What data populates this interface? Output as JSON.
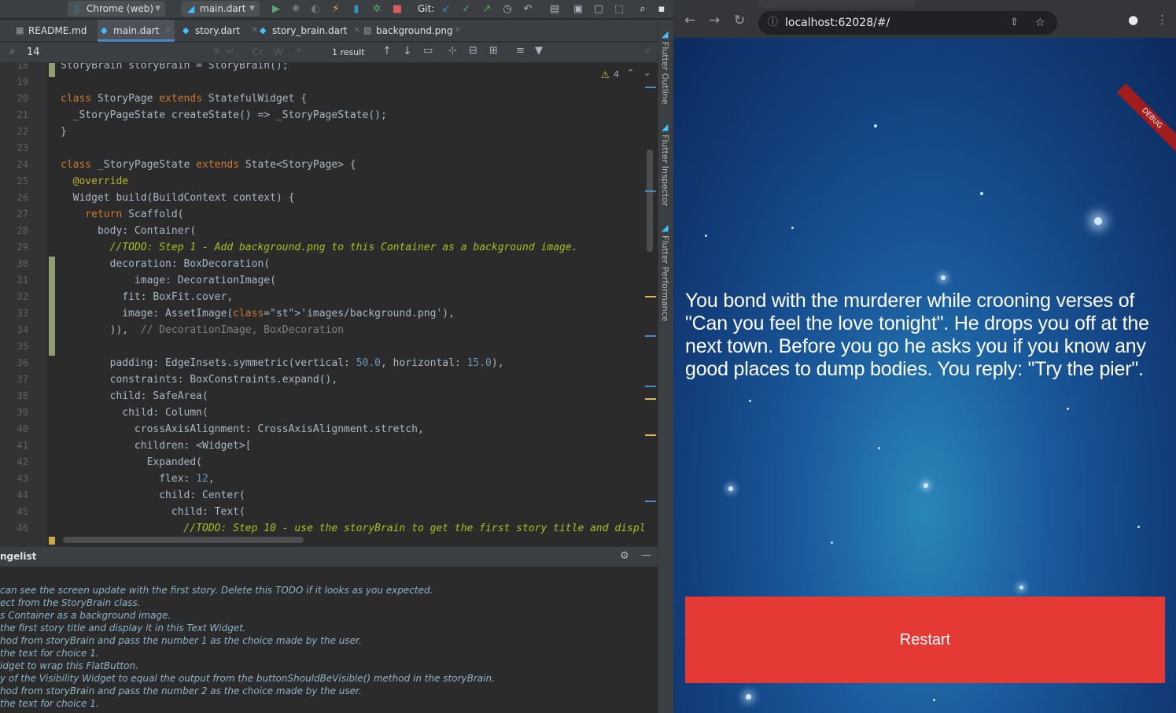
{
  "toolbar": {
    "device": "Chrome (web)",
    "run_config": "main.dart",
    "git_label": "Git:"
  },
  "tabs": [
    {
      "label": "README.md",
      "icon": "markdown-icon"
    },
    {
      "label": "main.dart",
      "icon": "dart-file-icon"
    },
    {
      "label": "story.dart",
      "icon": "dart-file-icon"
    },
    {
      "label": "story_brain.dart",
      "icon": "dart-file-icon"
    },
    {
      "label": "background.png",
      "icon": "image-file-icon"
    }
  ],
  "find": {
    "query": "14",
    "case_label": "Cc",
    "word_label": "W",
    "regex_label": ".*",
    "result": "1 result"
  },
  "editor": {
    "warning_count": "4"
  },
  "side_panels": [
    "Flutter Outline",
    "Flutter Inspector",
    "Flutter Performance"
  ],
  "code_lines": [
    {
      "num": "18",
      "text": "StoryBrain storyBrain = StoryBrain();"
    },
    {
      "num": "19",
      "text": ""
    },
    {
      "num": "20",
      "text": "class StoryPage extends StatefulWidget {"
    },
    {
      "num": "21",
      "text": "  _StoryPageState createState() => _StoryPageState();"
    },
    {
      "num": "22",
      "text": "}"
    },
    {
      "num": "23",
      "text": ""
    },
    {
      "num": "24",
      "text": "class _StoryPageState extends State<StoryPage> {"
    },
    {
      "num": "25",
      "text": "  @override"
    },
    {
      "num": "26",
      "text": "  Widget build(BuildContext context) {"
    },
    {
      "num": "27",
      "text": "    return Scaffold("
    },
    {
      "num": "28",
      "text": "      body: Container("
    },
    {
      "num": "29",
      "text": "        //TODO: Step 1 - Add background.png to this Container as a background image."
    },
    {
      "num": "30",
      "text": "        decoration: BoxDecoration("
    },
    {
      "num": "31",
      "text": "            image: DecorationImage("
    },
    {
      "num": "32",
      "text": "          fit: BoxFit.cover,"
    },
    {
      "num": "33",
      "text": "          image: AssetImage('images/background.png'),"
    },
    {
      "num": "34",
      "text": "        )),  // DecorationImage, BoxDecoration"
    },
    {
      "num": "35",
      "text": ""
    },
    {
      "num": "36",
      "text": "        padding: EdgeInsets.symmetric(vertical: 50.0, horizontal: 15.0),"
    },
    {
      "num": "37",
      "text": "        constraints: BoxConstraints.expand(),"
    },
    {
      "num": "38",
      "text": "        child: SafeArea("
    },
    {
      "num": "39",
      "text": "          child: Column("
    },
    {
      "num": "40",
      "text": "            crossAxisAlignment: CrossAxisAlignment.stretch,"
    },
    {
      "num": "41",
      "text": "            children: <Widget>["
    },
    {
      "num": "42",
      "text": "              Expanded("
    },
    {
      "num": "43",
      "text": "                flex: 12,"
    },
    {
      "num": "44",
      "text": "                child: Center("
    },
    {
      "num": "45",
      "text": "                  child: Text("
    },
    {
      "num": "46",
      "text": "                    //TODO: Step 10 - use the storyBrain to get the first story title and displ"
    }
  ],
  "todo": {
    "title": "ngelist",
    "lines": [
      "can see the screen update with the first story. Delete this TODO if it looks as you expected.",
      "ect from the StoryBrain class.",
      "s Container as a background image.",
      " the first story title and display it in this Text Widget.",
      "hod from storyBrain and pass the number 1 as the choice made by the user.",
      " the text for choice 1.",
      "idget to wrap this FlatButton.",
      "y of the Visibility Widget to equal the output from the buttonShouldBeVisible() method in the storyBrain.",
      "hod from storyBrain and pass the number 2 as the choice made by the user.",
      " the text for choice 1."
    ]
  },
  "browser": {
    "url": "localhost:62028/#/",
    "debug_label": "DEBUG"
  },
  "app": {
    "story": "You bond with the murderer while crooning verses of \"Can you feel the love tonight\". He drops you off at the next town. Before you go he asks you if you know any good places to dump bodies. You reply: \"Try the pier\".",
    "button": "Restart",
    "button_color": "#e53935"
  }
}
